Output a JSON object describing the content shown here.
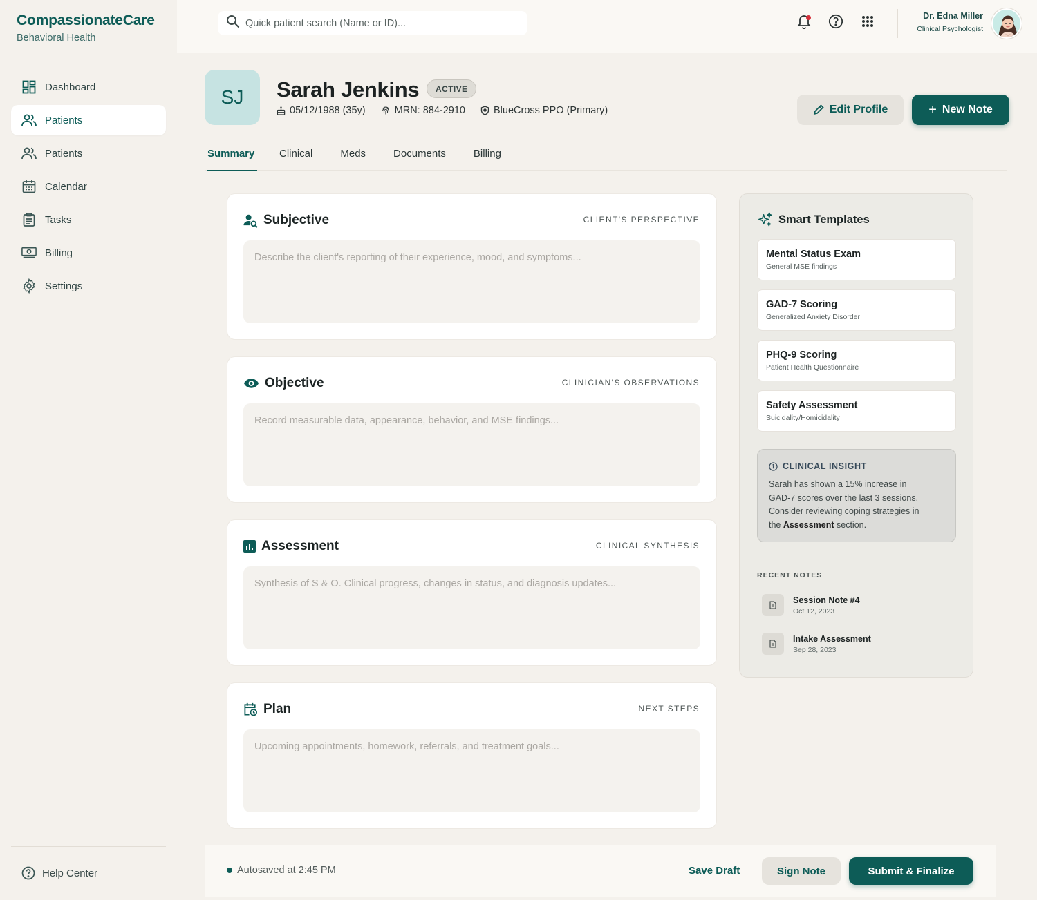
{
  "brand": {
    "title": "CompassionateCare",
    "subtitle": "Behavioral Health"
  },
  "sidebar": {
    "items": [
      {
        "label": "Dashboard",
        "icon": "dashboard-icon"
      },
      {
        "label": "Patients",
        "icon": "patients-icon",
        "active": true
      },
      {
        "label": "Patients",
        "icon": "patients-icon"
      },
      {
        "label": "Calendar",
        "icon": "calendar-icon"
      },
      {
        "label": "Tasks",
        "icon": "clipboard-icon"
      },
      {
        "label": "Billing",
        "icon": "billing-icon"
      },
      {
        "label": "Settings",
        "icon": "gear-icon"
      }
    ],
    "help": "Help Center"
  },
  "topbar": {
    "search_placeholder": "Quick patient search (Name or ID)...",
    "user_name": "Dr. Edna Miller",
    "user_role": "Clinical Psychologist"
  },
  "patient": {
    "initials": "SJ",
    "name": "Sarah Jenkins",
    "status": "ACTIVE",
    "dob": "05/12/1988 (35y)",
    "mrn": "MRN: 884-2910",
    "insurance": "BlueCross PPO (Primary)"
  },
  "actions": {
    "edit": "Edit Profile",
    "new_note": "New Note"
  },
  "tabs": [
    "Summary",
    "Clinical",
    "Meds",
    "Documents",
    "Billing"
  ],
  "soap": {
    "subjective": {
      "title": "Subjective",
      "tag": "CLIENT'S PERSPECTIVE",
      "placeholder": "Describe the client's reporting of their experience, mood, and symptoms..."
    },
    "objective": {
      "title": "Objective",
      "tag": "CLINICIAN'S OBSERVATIONS",
      "placeholder": "Record measurable data, appearance, behavior, and MSE findings..."
    },
    "assessment": {
      "title": "Assessment",
      "tag": "CLINICAL SYNTHESIS",
      "placeholder": "Synthesis of S & O. Clinical progress, changes in status, and diagnosis updates..."
    },
    "plan": {
      "title": "Plan",
      "tag": "NEXT STEPS",
      "placeholder": "Upcoming appointments, homework, referrals, and treatment goals..."
    }
  },
  "panel": {
    "title": "Smart Templates",
    "templates": [
      {
        "name": "Mental Status Exam",
        "desc": "General MSE findings"
      },
      {
        "name": "GAD-7 Scoring",
        "desc": "Generalized Anxiety Disorder"
      },
      {
        "name": "PHQ-9 Scoring",
        "desc": "Patient Health Questionnaire"
      },
      {
        "name": "Safety Assessment",
        "desc": "Suicidality/Homicidality"
      }
    ],
    "insight": {
      "title": "CLINICAL INSIGHT",
      "text_before": "Sarah has shown a 15% increase in GAD-7 scores over the last 3 sessions. Consider reviewing coping strategies in the ",
      "text_bold": "Assessment",
      "text_after": " section."
    },
    "recent_label": "RECENT NOTES",
    "recent": [
      {
        "title": "Session Note #4",
        "date": "Oct 12, 2023"
      },
      {
        "title": "Intake Assessment",
        "date": "Sep 28, 2023"
      }
    ]
  },
  "footer": {
    "autosave": "Autosaved at 2:45 PM",
    "save_draft": "Save Draft",
    "sign": "Sign Note",
    "submit": "Submit & Finalize"
  },
  "colors": {
    "primary": "#0d5c57",
    "background": "#f4f1ec",
    "notification": "#d62f3a"
  }
}
